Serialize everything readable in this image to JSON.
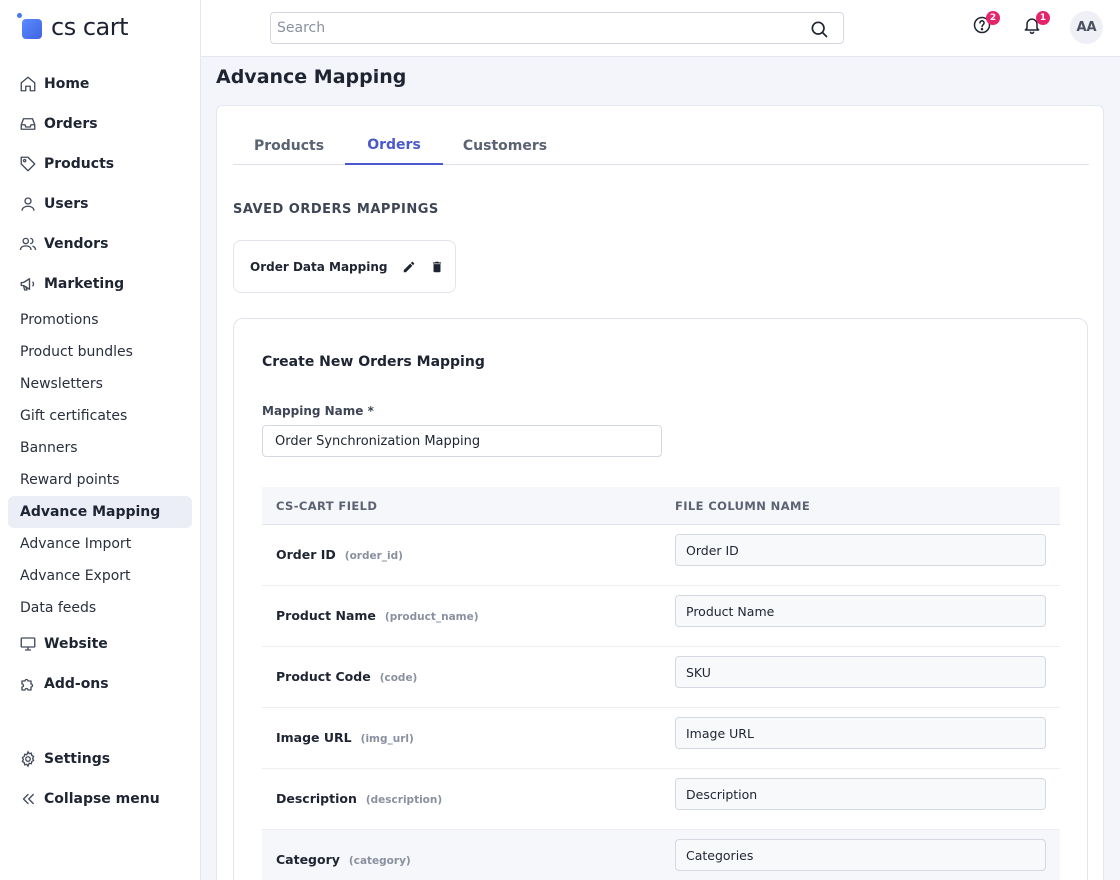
{
  "app": {
    "logo_text": "cs cart"
  },
  "sidebar": {
    "main_items": [
      {
        "label": "Home",
        "icon": "home-icon"
      },
      {
        "label": "Orders",
        "icon": "inbox-icon"
      },
      {
        "label": "Products",
        "icon": "tag-icon"
      },
      {
        "label": "Users",
        "icon": "user-icon"
      },
      {
        "label": "Vendors",
        "icon": "users-icon"
      },
      {
        "label": "Marketing",
        "icon": "megaphone-icon"
      }
    ],
    "marketing_sub": [
      {
        "label": "Promotions"
      },
      {
        "label": "Product bundles"
      },
      {
        "label": "Newsletters"
      },
      {
        "label": "Gift certificates"
      },
      {
        "label": "Banners"
      },
      {
        "label": "Reward points"
      },
      {
        "label": "Advance Mapping",
        "active": true
      },
      {
        "label": "Advance Import"
      },
      {
        "label": "Advance Export"
      },
      {
        "label": "Data feeds"
      }
    ],
    "lower_items": [
      {
        "label": "Website",
        "icon": "monitor-icon"
      },
      {
        "label": "Add-ons",
        "icon": "puzzle-icon"
      }
    ],
    "settings": {
      "label": "Settings",
      "icon": "gear-icon"
    },
    "collapse": {
      "label": "Collapse menu",
      "icon": "double-chevron-left-icon"
    }
  },
  "topbar": {
    "search_placeholder": "Search",
    "help_badge": "2",
    "notifications_badge": "1",
    "avatar_initials": "AA"
  },
  "page": {
    "title": "Advance Mapping"
  },
  "tabs": [
    {
      "label": "Products"
    },
    {
      "label": "Orders",
      "active": true
    },
    {
      "label": "Customers"
    }
  ],
  "saved": {
    "heading": "SAVED ORDERS MAPPINGS",
    "items": [
      {
        "name": "Order Data Mapping"
      }
    ]
  },
  "create": {
    "title": "Create New Orders Mapping",
    "name_label": "Mapping Name *",
    "name_value": "Order Synchronization Mapping",
    "table": {
      "col_field": "CS-CART FIELD",
      "col_file": "FILE COLUMN NAME",
      "rows": [
        {
          "field": "Order ID",
          "key": "(order_id)",
          "value": "Order ID"
        },
        {
          "field": "Product Name",
          "key": "(product_name)",
          "value": "Product Name"
        },
        {
          "field": "Product Code",
          "key": "(code)",
          "value": "SKU"
        },
        {
          "field": "Image URL",
          "key": "(img_url)",
          "value": "Image URL"
        },
        {
          "field": "Description",
          "key": "(description)",
          "value": "Description"
        },
        {
          "field": "Category",
          "key": "(category)",
          "value": "Categories",
          "highlight": true
        }
      ]
    }
  },
  "colors": {
    "accent": "#4a5acd",
    "badge": "#e5246b",
    "active_nav_bg": "#ebeef7"
  }
}
